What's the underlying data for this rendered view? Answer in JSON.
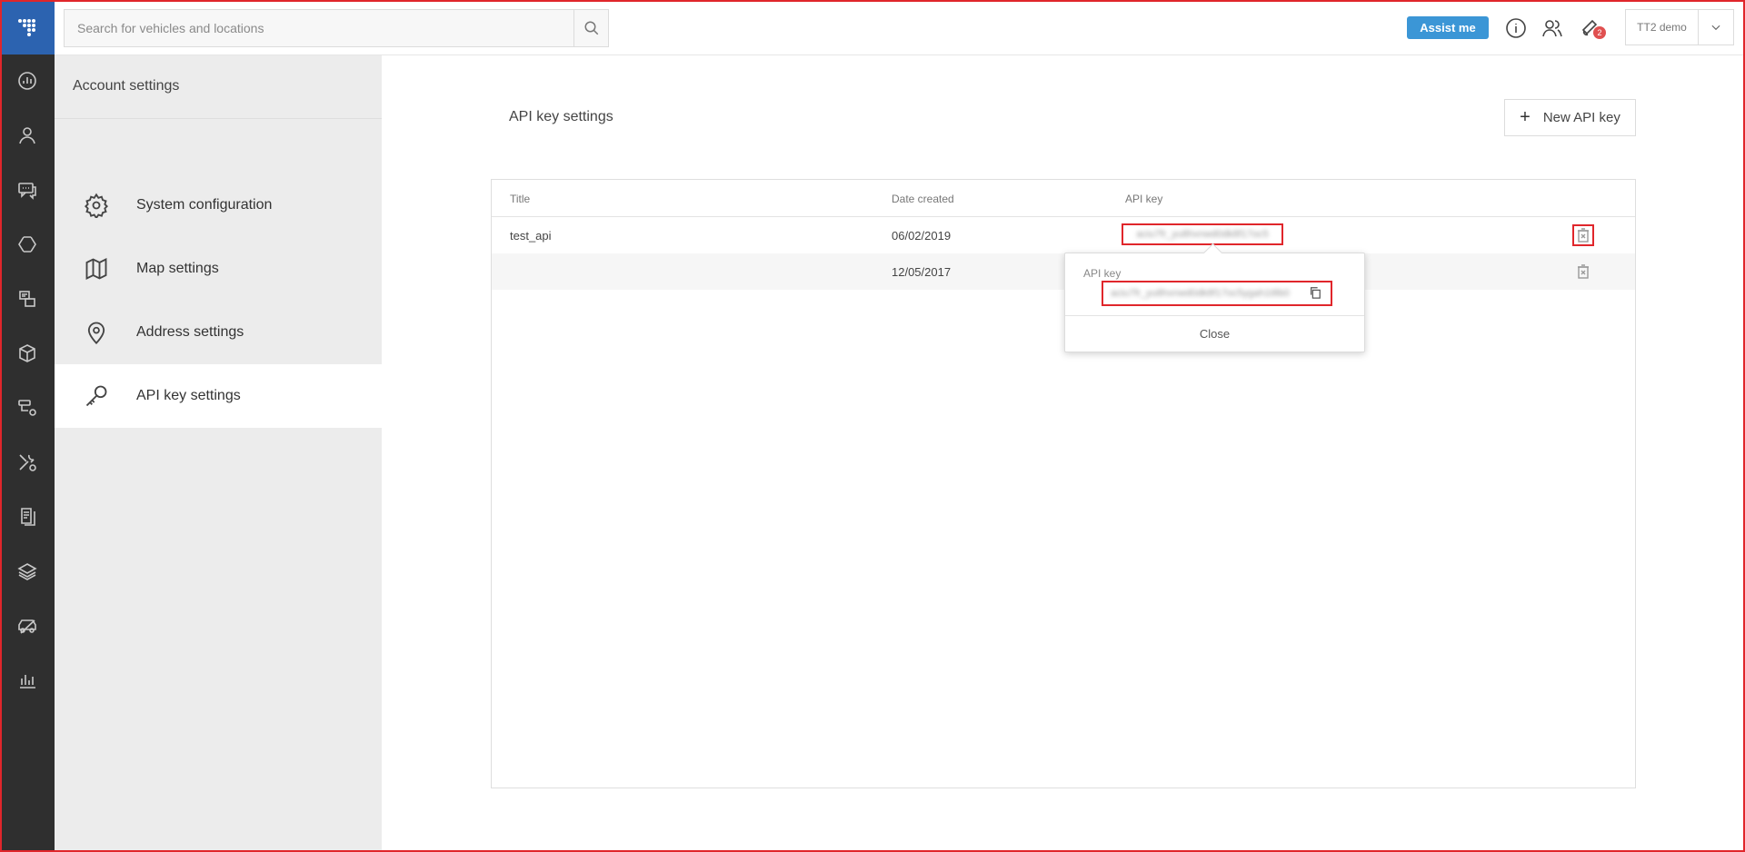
{
  "search": {
    "placeholder": "Search for vehicles and locations"
  },
  "topbar": {
    "assist_label": "Assist me",
    "notification_count": "2",
    "user_name": "TT2 demo"
  },
  "rail": {
    "items": [
      "dashboard-icon",
      "person-icon",
      "chat-icon",
      "routes-icon",
      "documents-icon",
      "package-icon",
      "workflow-icon",
      "tools-icon",
      "reports-icon",
      "layers-icon",
      "vehicle-icon",
      "chart-icon"
    ]
  },
  "settings": {
    "title": "Account settings",
    "items": [
      {
        "label": "System configuration",
        "icon": "gear-icon"
      },
      {
        "label": "Map settings",
        "icon": "map-icon"
      },
      {
        "label": "Address settings",
        "icon": "location-pin-icon"
      },
      {
        "label": "API key settings",
        "icon": "key-icon"
      }
    ]
  },
  "main": {
    "title": "API key settings",
    "new_button_label": "New API key",
    "columns": {
      "title": "Title",
      "date": "Date created",
      "key": "API key"
    },
    "rows": [
      {
        "title": "test_api",
        "date": "06/02/2019",
        "key": "aciu7fr_yu8hxnwd0dk8f17oc5"
      },
      {
        "title": "",
        "date": "12/05/2017",
        "key": ""
      }
    ]
  },
  "popover": {
    "label": "API key",
    "value": "aciu7fr_yu8hxnwd0dk8f17oc5ygah1t8b0",
    "close_label": "Close"
  }
}
